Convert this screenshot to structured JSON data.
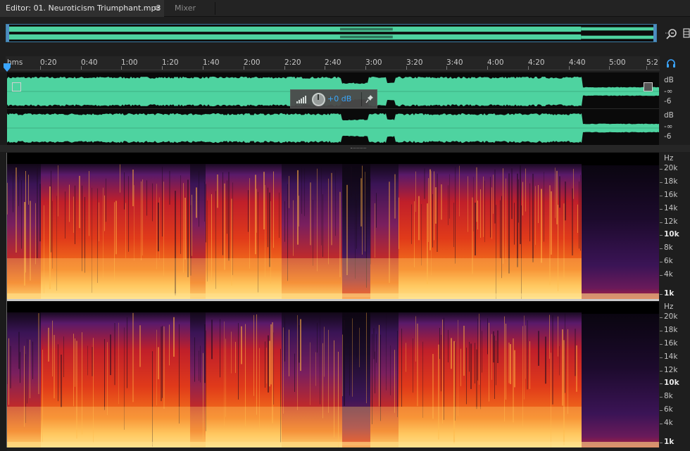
{
  "tabs": {
    "editor_label": "Editor: 01. Neuroticism Triumphant.mp3",
    "menu_glyph": "≡",
    "mixer_label": "Mixer"
  },
  "icons": {
    "zoom": "zoom-icon",
    "headphones": "headphones-icon",
    "pin": "pin-icon",
    "playhead": "playhead-icon",
    "menu": "menu-icon",
    "level-meter": "level-meter-icon",
    "volume-knob": "volume-knob-icon"
  },
  "ruler": {
    "unit_label": "hms",
    "labels": [
      "0:20",
      "0:40",
      "1:00",
      "1:20",
      "1:40",
      "2:00",
      "2:20",
      "2:40",
      "3:00",
      "3:20",
      "3:40",
      "4:00",
      "4:20",
      "4:40",
      "5:00",
      "5:2"
    ]
  },
  "waveform": {
    "channel1": {
      "unit": "dB",
      "inf": "-∞",
      "minus6": "-6"
    },
    "channel2": {
      "unit": "dB",
      "inf": "-∞",
      "minus6": "-6"
    }
  },
  "hud": {
    "volume": "+0 dB"
  },
  "spectral": {
    "unit": "Hz",
    "labels": [
      "20k",
      "18k",
      "16k",
      "14k",
      "12k",
      "10k",
      "8k",
      "6k",
      "4k",
      "1k"
    ]
  },
  "colors": {
    "waveform": "#4ed3a0",
    "accent": "#3aa5ff",
    "overview_border": "#3d7ea6"
  }
}
